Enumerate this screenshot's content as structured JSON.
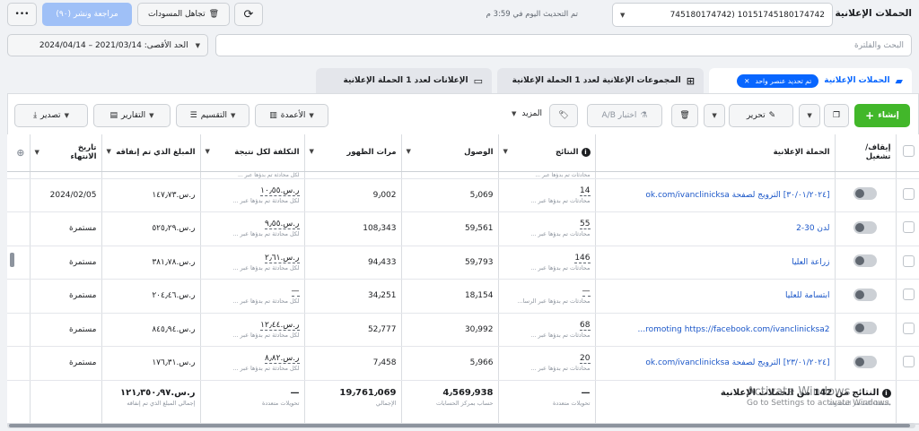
{
  "topbar": {
    "page_title": "الحملات الإعلانية",
    "campaign_selector_value": "745180174742) 10151745180174742",
    "updated_text": "تم التحديث اليوم في 3:59 م",
    "discard_label": "تجاهل المسودات",
    "review_publish_label": "مراجعة ونشر (٩٠)"
  },
  "filters": {
    "search_placeholder": "البحث والفلترة",
    "date_label": "الحد الأقصى: 2021/03/14 – 2024/04/14"
  },
  "tabs": [
    {
      "label": "الحملات الإعلانية",
      "chip": "تم تحديد عنصر واحد"
    },
    {
      "label": "المجموعات الإعلانية لعدد 1 الحملة الإعلانية"
    },
    {
      "label": "الإعلانات لعدد 1 الحملة الإعلانية"
    }
  ],
  "toolbar": {
    "create": "إنشاء",
    "edit": "تحرير",
    "ab_test": "اختبار A/B",
    "more": "المزيد",
    "columns": "الأعمدة",
    "breakdown": "التقسيم",
    "reports": "التقارير",
    "export": "تصدير"
  },
  "columns": {
    "toggle": "إيقاف/ تشغيل",
    "campaign": "الحملة الإعلانية",
    "results": "النتائج",
    "reach": "الوصول",
    "impressions": "مرات الظهور",
    "cost_per_result": "التكلفة لكل نتيجة",
    "amount_spent": "المبلغ الذي تم إنفاقه",
    "end_date": "تاريخ الانتهاء"
  },
  "peek_row": {
    "results_sub": "محادثات تم بدؤها عبر ...",
    "cost_sub": "لكل محادثة تم بدؤها عبر ..."
  },
  "rows": [
    {
      "name": "[٣٠/٠١/٢٠٢٤] الترويج لصفحة ok.com/ivanclinicksa",
      "results": "14",
      "results_sub": "محادثات تم بدؤها عبر ...",
      "reach": "5٫069",
      "impressions": "9٫002",
      "cost": "ر.س.١٠٫٥٥",
      "cost_sub": "لكل محادثة تم بدؤها عبر ...",
      "spent": "ر.س.١٤٧٫٧٣",
      "end": "2024/02/05"
    },
    {
      "name": "لدن 30-2",
      "results": "55",
      "results_sub": "محادثات تم بدؤها عبر ...",
      "reach": "59٫561",
      "impressions": "108٫343",
      "cost": "ر.س.٩٫٥٥",
      "cost_sub": "لكل محادثة تم بدؤها عبر ...",
      "spent": "ر.س.٥٢٥٫٢٩",
      "end": "مستمرة"
    },
    {
      "name": "زراعة العليا",
      "results": "146",
      "results_sub": "محادثات تم بدؤها عبر ...",
      "reach": "59٫793",
      "impressions": "94٫433",
      "cost": "ر.س.٢٫٦١",
      "cost_sub": "لكل محادثة تم بدؤها عبر ...",
      "spent": "ر.س.٣٨١٫٧٨",
      "end": "مستمرة"
    },
    {
      "name": "ابتسامة للعليا",
      "results": "—",
      "results_sub": "محادثات تم بدؤها عبر الرسا...",
      "reach": "18٫154",
      "impressions": "34٫251",
      "cost": "—",
      "cost_sub": "لكل محادثة تم بدؤها عبر ...",
      "spent": "ر.س.٢٠٤٫٤٦",
      "end": "مستمرة"
    },
    {
      "name": "romoting https://facebook.com/ivanclinicksa2...",
      "results": "68",
      "results_sub": "محادثات تم بدؤها عبر ...",
      "reach": "30٫992",
      "impressions": "52٫777",
      "cost": "ر.س.١٢٫٤٤",
      "cost_sub": "لكل محادثة تم بدؤها عبر ...",
      "spent": "ر.س.٨٤٥٫٩٤",
      "end": "مستمرة"
    },
    {
      "name": "[٢٣/٠١/٢٠٢٤] الترويج لصفحة ok.com/ivanclinicksa",
      "results": "20",
      "results_sub": "محادثات تم بدؤها عبر ...",
      "reach": "5٫966",
      "impressions": "7٫458",
      "cost": "ر.س.٨٫٨٢",
      "cost_sub": "لكل محادثة تم بدؤها عبر ...",
      "spent": "ر.س.١٧٦٫٣١",
      "end": "مستمرة"
    }
  ],
  "totals": {
    "label": "النتائج من 142 من الحملات الإعلانية",
    "label_sub": "باستثناء العناصر المحذوفة",
    "results": "—",
    "results_sub": "تحويلات متعددة",
    "reach": "4٫569٫938",
    "reach_sub": "حساب بمركز الحسابات",
    "impressions": "19٫761٫069",
    "impressions_sub": "الإجمالي",
    "cost": "—",
    "cost_sub": "تحويلات متعددة",
    "spent": "ر.س.١٢١٫٣٥٠٫٩٧",
    "spent_sub": "إجمالي المبلغ الذي تم إنفاقه"
  },
  "watermark": {
    "title": "Activate Windows",
    "sub": "Go to Settings to activate Windows."
  },
  "colors": {
    "primary": "#0866ff",
    "create": "#42b72a",
    "link": "#1a56c8"
  }
}
